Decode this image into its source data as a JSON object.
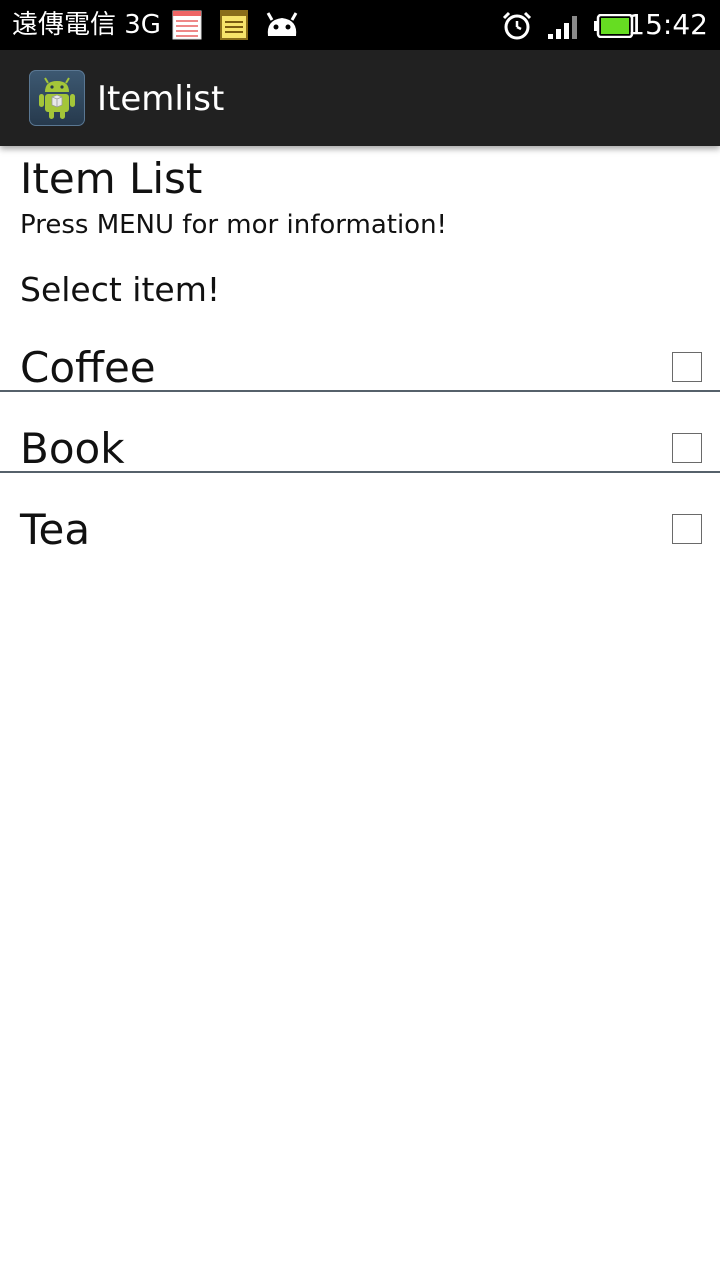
{
  "status_bar": {
    "carrier": "遠傳電信 3G",
    "time": "15:42",
    "icons": [
      "calendar-note-icon",
      "notepad-icon",
      "android-notification-icon",
      "alarm-icon",
      "signal-icon",
      "battery-icon"
    ],
    "battery_color": "#66dd22"
  },
  "action_bar": {
    "title": "Itemlist",
    "background": "#212121"
  },
  "content": {
    "heading": "Item List",
    "subtext": "Press MENU for mor information!",
    "select_label": "Select item!",
    "items": [
      {
        "label": "Coffee",
        "checked": false
      },
      {
        "label": "Book",
        "checked": false
      },
      {
        "label": "Tea",
        "checked": false
      }
    ]
  }
}
